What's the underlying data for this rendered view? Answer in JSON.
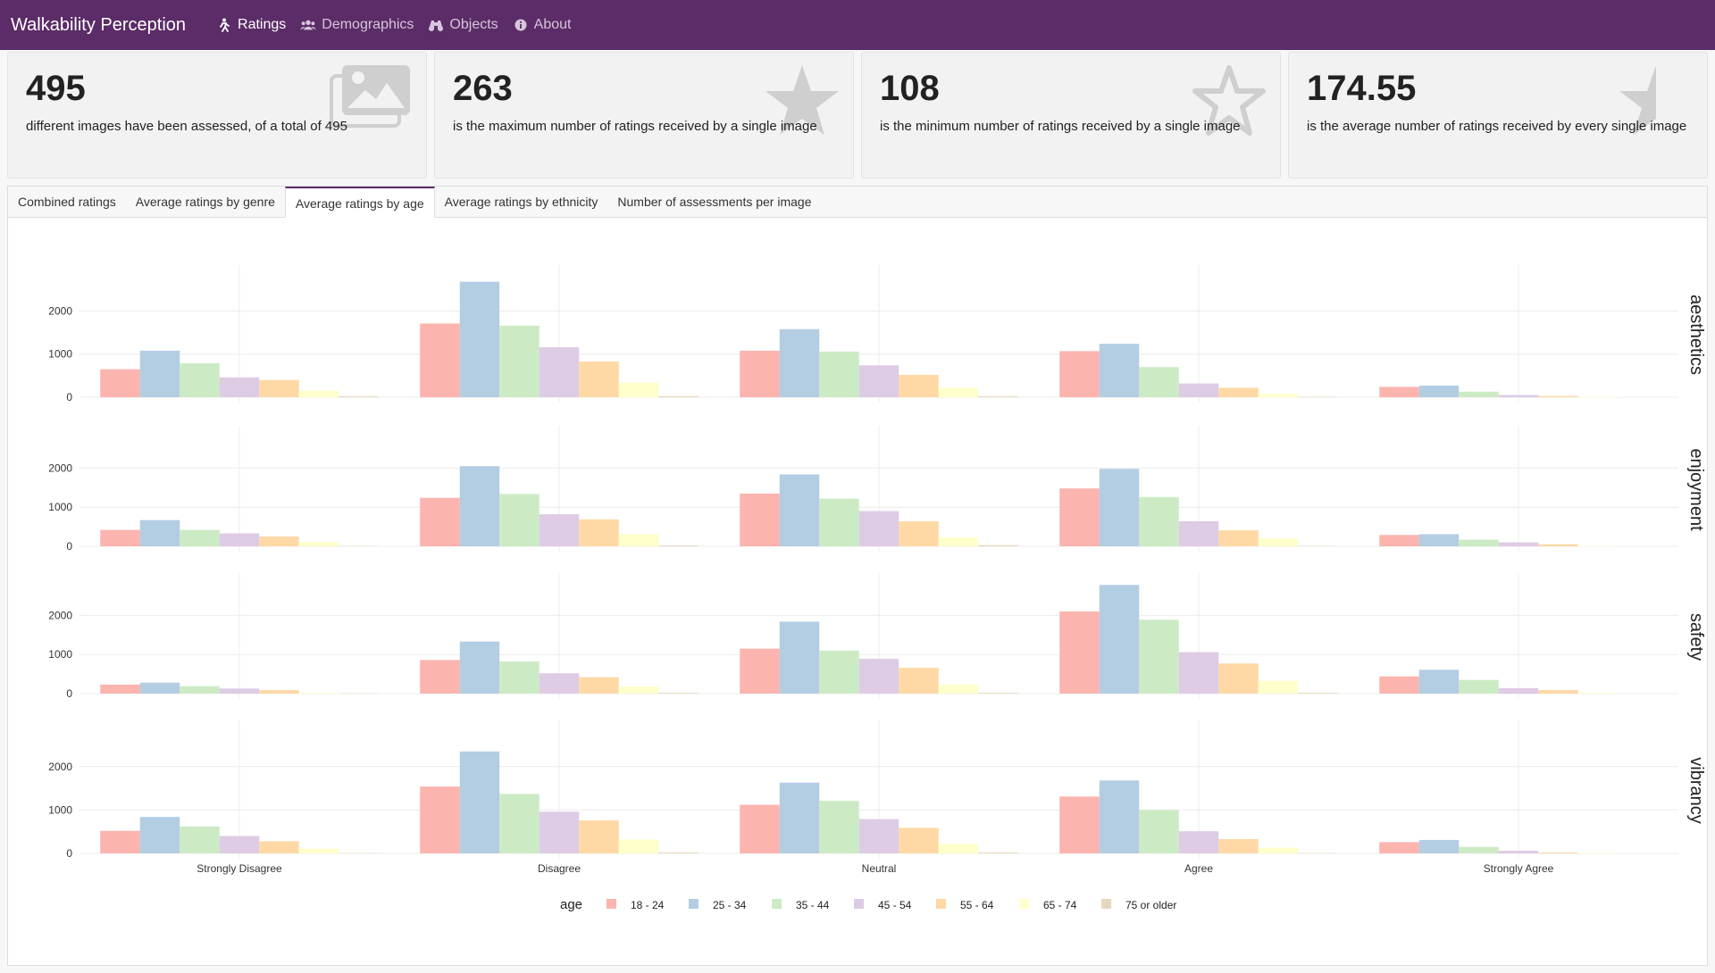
{
  "nav": {
    "brand": "Walkability Perception",
    "items": [
      {
        "label": "Ratings",
        "icon": "walking-person-icon",
        "active": true
      },
      {
        "label": "Demographics",
        "icon": "users-icon",
        "active": false
      },
      {
        "label": "Objects",
        "icon": "binoculars-icon",
        "active": false
      },
      {
        "label": "About",
        "icon": "info-icon",
        "active": false
      }
    ]
  },
  "stats": [
    {
      "value": "495",
      "description": "different images have been assessed, of a total of 495",
      "icon": "image-icon"
    },
    {
      "value": "263",
      "description": "is the maximum number of ratings received by a single image",
      "icon": "star-filled-icon"
    },
    {
      "value": "108",
      "description": "is the minimum number of ratings received by a single image",
      "icon": "star-outline-icon"
    },
    {
      "value": "174.55",
      "description": "is the average number of ratings received by every single image",
      "icon": "star-half-icon"
    }
  ],
  "tabs": [
    {
      "label": "Combined ratings",
      "active": false
    },
    {
      "label": "Average ratings by genre",
      "active": false
    },
    {
      "label": "Average ratings by age",
      "active": true
    },
    {
      "label": "Average ratings by ethnicity",
      "active": false
    },
    {
      "label": "Number of assessments per image",
      "active": false
    }
  ],
  "chart_data": {
    "type": "bar",
    "categories": [
      "Strongly Disagree",
      "Disagree",
      "Neutral",
      "Agree",
      "Strongly Agree"
    ],
    "legend_title": "age",
    "legend_position": "bottom",
    "grid": true,
    "yticks": [
      0,
      1000,
      2000
    ],
    "ylim": [
      0,
      2900
    ],
    "groups": [
      "18 - 24",
      "25 - 34",
      "35 - 44",
      "45 - 54",
      "55 - 64",
      "65 - 74",
      "75 or older"
    ],
    "colors": [
      "#fbb4ae",
      "#b3cde3",
      "#ccebc5",
      "#decbe4",
      "#fed9a6",
      "#ffffcc",
      "#e5d8bd"
    ],
    "facets": [
      {
        "name": "aesthetics",
        "values": [
          [
            650,
            1080,
            790,
            460,
            400,
            150,
            20
          ],
          [
            1710,
            2680,
            1660,
            1160,
            830,
            340,
            25
          ],
          [
            1080,
            1580,
            1060,
            740,
            520,
            220,
            20
          ],
          [
            1070,
            1240,
            700,
            320,
            220,
            80,
            10
          ],
          [
            240,
            270,
            130,
            50,
            30,
            10,
            0
          ]
        ]
      },
      {
        "name": "enjoyment",
        "values": [
          [
            420,
            670,
            420,
            330,
            250,
            110,
            10
          ],
          [
            1240,
            2050,
            1340,
            820,
            690,
            310,
            20
          ],
          [
            1350,
            1840,
            1220,
            900,
            640,
            230,
            30
          ],
          [
            1480,
            1980,
            1260,
            640,
            410,
            200,
            10
          ],
          [
            290,
            310,
            170,
            100,
            50,
            10,
            0
          ]
        ]
      },
      {
        "name": "safety",
        "values": [
          [
            230,
            280,
            190,
            130,
            90,
            20,
            10
          ],
          [
            860,
            1330,
            820,
            520,
            420,
            180,
            20
          ],
          [
            1150,
            1840,
            1100,
            890,
            660,
            230,
            20
          ],
          [
            2100,
            2780,
            1890,
            1060,
            770,
            330,
            20
          ],
          [
            440,
            610,
            350,
            140,
            90,
            20,
            0
          ]
        ]
      },
      {
        "name": "vibrancy",
        "values": [
          [
            520,
            840,
            620,
            400,
            280,
            110,
            10
          ],
          [
            1540,
            2350,
            1370,
            960,
            760,
            320,
            20
          ],
          [
            1120,
            1630,
            1210,
            790,
            590,
            220,
            20
          ],
          [
            1310,
            1680,
            1000,
            510,
            330,
            130,
            10
          ],
          [
            260,
            310,
            150,
            60,
            20,
            10,
            0
          ]
        ]
      }
    ]
  }
}
